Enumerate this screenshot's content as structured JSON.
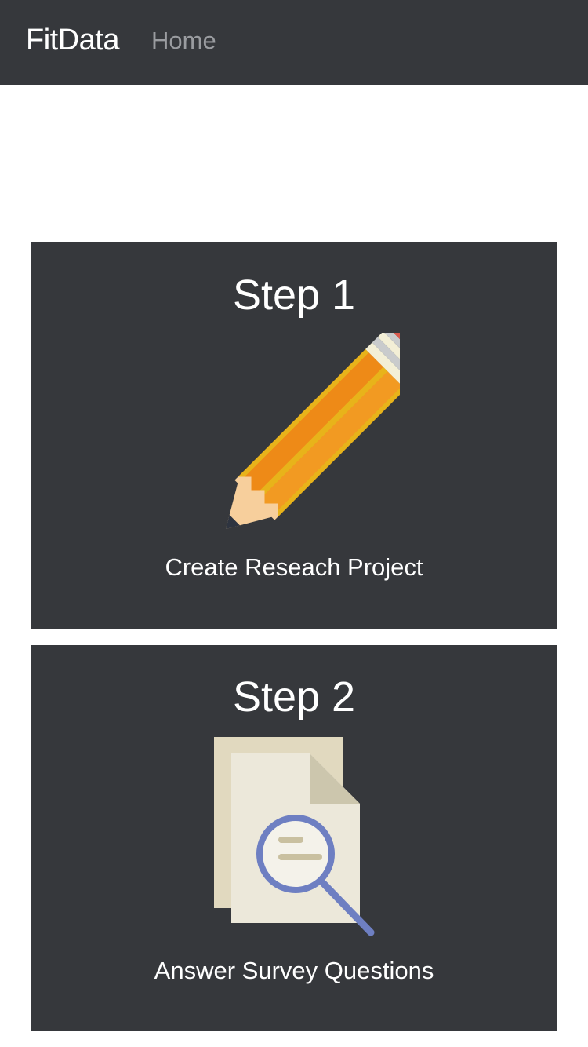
{
  "navbar": {
    "brand": "FitData",
    "home_label": "Home"
  },
  "steps": [
    {
      "title": "Step 1",
      "caption": "Create Reseach Project",
      "icon": "pencil-icon"
    },
    {
      "title": "Step 2",
      "caption": "Answer Survey Questions",
      "icon": "document-search-icon"
    }
  ],
  "colors": {
    "navbar_bg": "#36383c",
    "card_bg": "#36383c",
    "text": "#ffffff",
    "nav_link": "#9a9ca0"
  }
}
